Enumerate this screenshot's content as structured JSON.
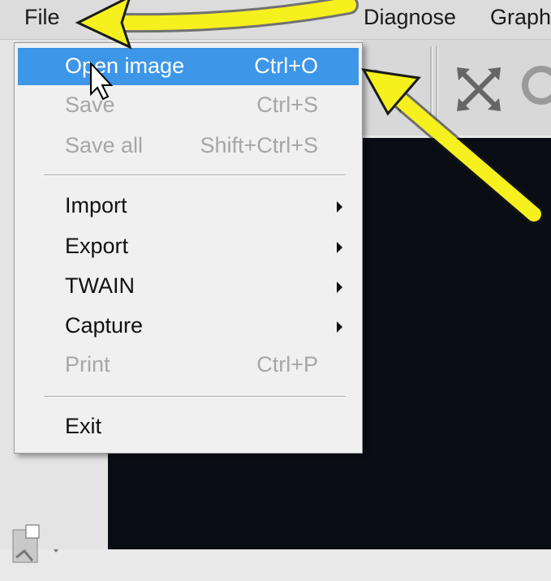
{
  "menubar": {
    "items": [
      {
        "label": "File"
      },
      {
        "label": "Diagnose"
      },
      {
        "label": "Graph"
      }
    ]
  },
  "file_menu": {
    "items": [
      {
        "label": "Open image",
        "shortcut": "Ctrl+O",
        "state": "highlighted"
      },
      {
        "label": "Save",
        "shortcut": "Ctrl+S",
        "state": "disabled"
      },
      {
        "label": "Save all",
        "shortcut": "Shift+Ctrl+S",
        "state": "disabled"
      },
      {
        "label": "Import",
        "submenu": true
      },
      {
        "label": "Export",
        "submenu": true
      },
      {
        "label": "TWAIN",
        "submenu": true
      },
      {
        "label": "Capture",
        "submenu": true
      },
      {
        "label": "Print",
        "shortcut": "Ctrl+P",
        "state": "disabled"
      },
      {
        "label": "Exit"
      }
    ]
  },
  "toolbar": {
    "icons": [
      "pointer-tool-icon",
      "fit-window-icon",
      "zoom-icon"
    ]
  },
  "annotations": {
    "arrows": [
      "arrow-pointing-to-file-menu",
      "arrow-pointing-to-open-image"
    ],
    "arrow_color": "#f5f01e"
  },
  "colors": {
    "highlight": "#3d96e8",
    "canvas": "#0a0d13"
  }
}
